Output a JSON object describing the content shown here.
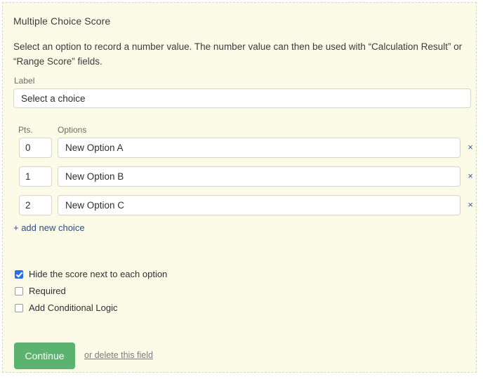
{
  "panel": {
    "title": "Multiple Choice Score",
    "description": "Select an option to record a number value. The number value can then be used with “Calculation Result” or “Range Score” fields."
  },
  "label_field": {
    "caption": "Label",
    "value": "Select a choice",
    "placeholder": "Label"
  },
  "choices": {
    "pts_header": "Pts.",
    "options_header": "Options",
    "remove_icon": "×",
    "rows": [
      {
        "points": "0",
        "option": "New Option A"
      },
      {
        "points": "1",
        "option": "New Option B"
      },
      {
        "points": "2",
        "option": "New Option C"
      }
    ],
    "add_link": "+ add new choice"
  },
  "checkboxes": [
    {
      "label": "Hide the score next to each option",
      "checked": true
    },
    {
      "label": "Required",
      "checked": false
    },
    {
      "label": "Add Conditional Logic",
      "checked": false
    }
  ],
  "footer": {
    "continue_label": "Continue",
    "delete_label": "or delete this field"
  },
  "colors": {
    "panel_background": "#fbfbe8",
    "panel_border": "#d8d8c2",
    "accent_green": "#5cb370",
    "link_blue": "#2d4b86",
    "checkbox_blue": "#2a6ef0",
    "remove_blue": "#3a5a9b"
  }
}
